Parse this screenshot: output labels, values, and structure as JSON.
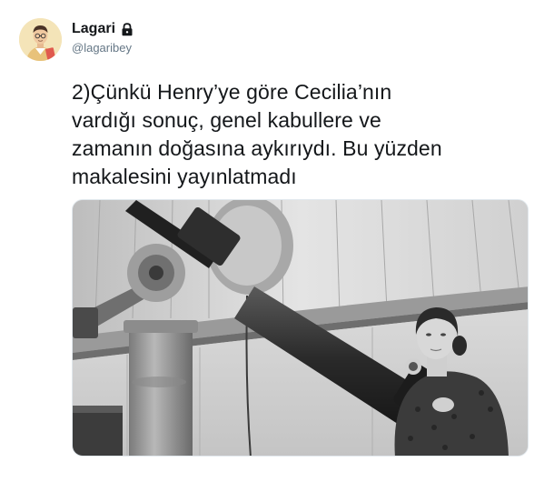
{
  "author": {
    "display_name": "Lagari",
    "handle": "@lagaribey",
    "protected_icon": "lock-icon",
    "avatar_icon": "avatar-illustration"
  },
  "tweet": {
    "text_lines": [
      "2)Çünkü Henry’ye göre Cecilia’nın",
      "vardığı sonuç, genel kabullere ve",
      "zamanın doğasına aykırıydı. Bu yüzden",
      "makalesini yayınlatmadı"
    ]
  },
  "media": {
    "type": "photo",
    "style": "black-and-white"
  },
  "colors": {
    "text": "#14171a",
    "secondary_text": "#657786",
    "border": "#e1e8ed"
  }
}
